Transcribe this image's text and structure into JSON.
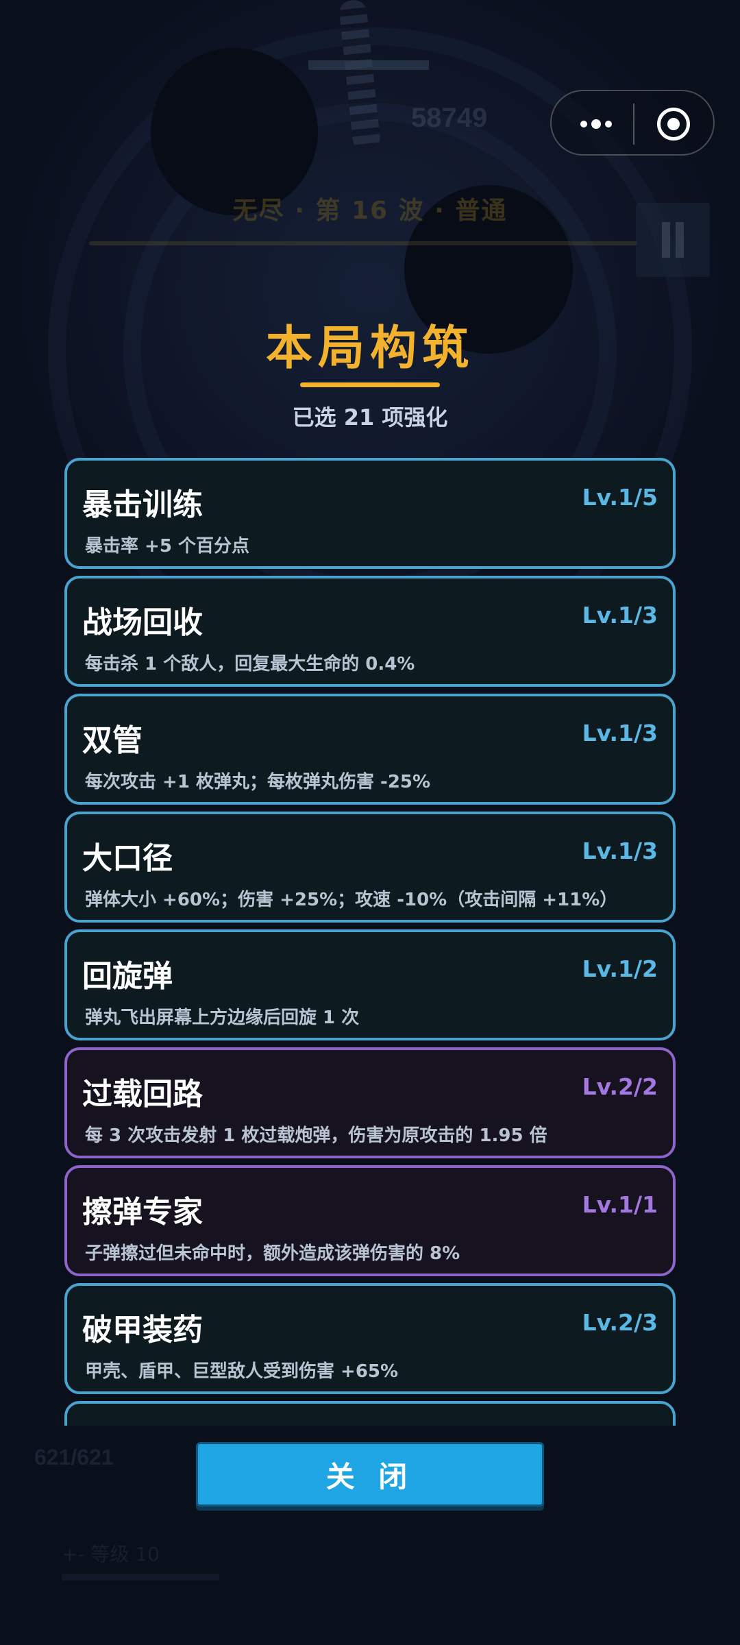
{
  "background": {
    "score": "58749",
    "wave_label": "无尽 · 第 16 波 · 普通",
    "hp": "621/621",
    "skill_label": "+- 等级 10"
  },
  "capsule": {
    "more_icon": "more-dots-icon",
    "close_icon": "target-circle-icon"
  },
  "panel": {
    "title": "本局构筑",
    "subtitle": "已选 21 项强化",
    "colors": {
      "title": "#f2b22e",
      "blue_border": "#4aa3cf",
      "purple_border": "#8e64c8",
      "button": "#1fa5e3"
    },
    "upgrades": [
      {
        "name": "暴击训练",
        "level": "Lv.1/5",
        "desc": "暴击率 +5 个百分点",
        "rarity": "blue"
      },
      {
        "name": "战场回收",
        "level": "Lv.1/3",
        "desc": "每击杀 1 个敌人，回复最大生命的 0.4%",
        "rarity": "blue"
      },
      {
        "name": "双管",
        "level": "Lv.1/3",
        "desc": "每次攻击 +1 枚弹丸；每枚弹丸伤害 -25%",
        "rarity": "blue"
      },
      {
        "name": "大口径",
        "level": "Lv.1/3",
        "desc": "弹体大小 +60%；伤害 +25%；攻速 -10%（攻击间隔 +11%）",
        "rarity": "blue"
      },
      {
        "name": "回旋弹",
        "level": "Lv.1/2",
        "desc": "弹丸飞出屏幕上方边缘后回旋 1 次",
        "rarity": "blue"
      },
      {
        "name": "过载回路",
        "level": "Lv.2/2",
        "desc": "每 3 次攻击发射 1 枚过载炮弹，伤害为原攻击的 1.95 倍",
        "rarity": "purple"
      },
      {
        "name": "擦弹专家",
        "level": "Lv.1/1",
        "desc": "子弹擦过但未命中时，额外造成该弹伤害的 8%",
        "rarity": "purple"
      },
      {
        "name": "破甲装药",
        "level": "Lv.2/3",
        "desc": "甲壳、盾甲、巨型敌人受到伤害 +65%",
        "rarity": "blue"
      }
    ],
    "close_label": "关 闭"
  }
}
